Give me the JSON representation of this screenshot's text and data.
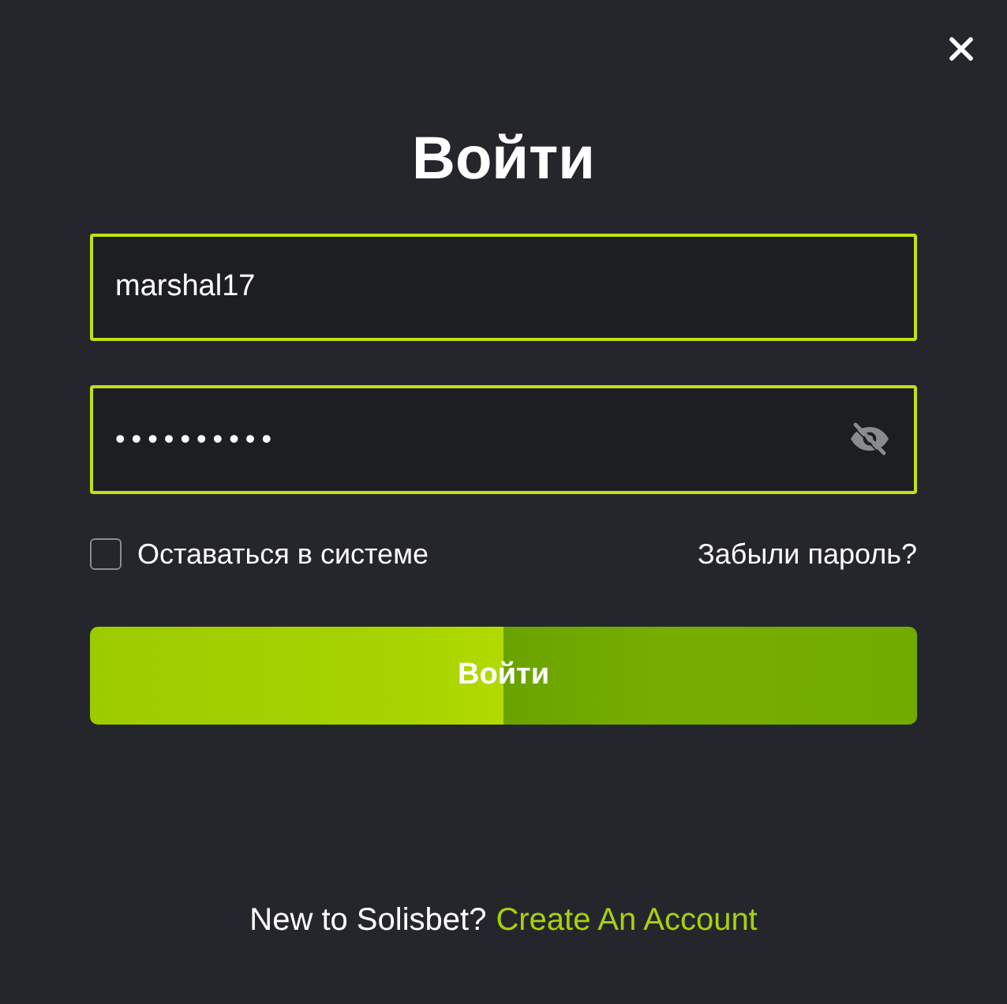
{
  "title": "Войти",
  "username": {
    "value": "marshal17"
  },
  "password": {
    "value": "••••••••••",
    "revealed": false
  },
  "remember_me": {
    "label": "Оставаться в системе",
    "checked": false
  },
  "forgot_password": "Забыли пароль?",
  "submit_button": "Войти",
  "footer": {
    "text": "New to Solisbet?",
    "link": "Create An Account"
  }
}
